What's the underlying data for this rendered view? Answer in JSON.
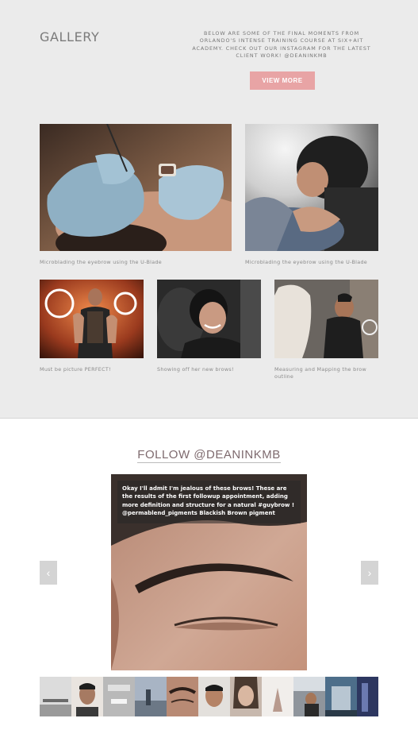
{
  "gallery": {
    "title": "GALLERY",
    "intro": "BELOW ARE SOME OF THE FINAL MOMENTS FROM ORLANDO'S INTENSE TRAINING COURSE AT SIX+AIT ACADEMY. CHECK OUT OUR INSTAGRAM FOR THE LATEST CLIENT WORK! @DEANINKMB",
    "view_more_label": "VIEW MORE",
    "items": [
      {
        "caption": "Microblading the eyebrow using the U-Blade"
      },
      {
        "caption": "Microblading the eyebrow using the U-Blade"
      },
      {
        "caption": "Must be picture PERFECT!"
      },
      {
        "caption": "Showing off her new brows!"
      },
      {
        "caption": "Measuring and Mapping the brow outline"
      }
    ]
  },
  "instagram": {
    "title": "FOLLOW @DEANINKMB",
    "post_caption": "Okay I'll admit I'm jealous of these brows! These are the results of the first followup appointment, adding more definition and structure for a natural #guybrow ! @permablend_pigments Blackish Brown pigment",
    "prev_icon": "‹",
    "next_icon": "›"
  },
  "colors": {
    "accent": "#e8a4a5",
    "gallery_bg": "#ebebeb"
  }
}
